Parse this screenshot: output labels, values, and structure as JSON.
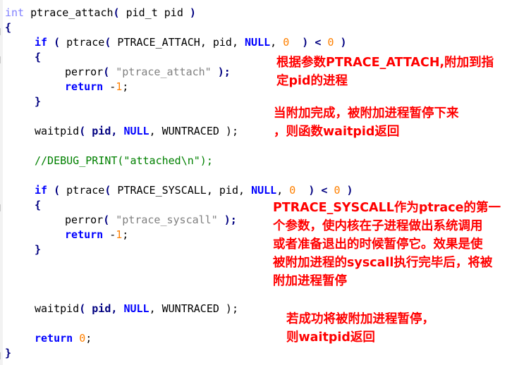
{
  "code": {
    "l1": {
      "type": "int",
      "name": " ptrace_attach",
      "p1": "( ",
      "ptype": "pid_t",
      "pname": " pid ",
      "p2": ")"
    },
    "l2": {
      "brace": "{"
    },
    "l3": {
      "if": "if",
      "a": " ( ",
      "fn": "ptrace",
      "b": "( ",
      "arg1": "PTRACE_ATTACH",
      "c": ", pid, ",
      "null": "NULL",
      "d": ", ",
      "zero": "0",
      "e": "  ) ",
      "lt": "<",
      "f": " ",
      "zero2": "0",
      "g": " )"
    },
    "l4": {
      "brace": "{"
    },
    "l5": {
      "fn": "perror",
      "a": "( ",
      "str": "\"ptrace_attach\"",
      "b": " );"
    },
    "l6": {
      "ret": "return",
      "a": " -",
      "one": "1",
      "b": ";"
    },
    "l7": {
      "brace": "}"
    },
    "l8": {
      "fn": "waitpid",
      "a": "( pid, ",
      "null": "NULL",
      "b": ", WUNTRACED );"
    },
    "l9": {
      "comment": "//DEBUG_PRINT(\"attached\\n\");"
    },
    "l10": {
      "if": "if",
      "a": " ( ",
      "fn": "ptrace",
      "b": "( ",
      "arg1": "PTRACE_SYSCALL",
      "c": ", pid, ",
      "null": "NULL",
      "d": ", ",
      "zero": "0",
      "e": "  ) ",
      "lt": "<",
      "f": " ",
      "zero2": "0",
      "g": " )"
    },
    "l11": {
      "brace": "{"
    },
    "l12": {
      "fn": "perror",
      "a": "( ",
      "str": "\"ptrace_syscall\"",
      "b": " );"
    },
    "l13": {
      "ret": "return",
      "a": " -",
      "one": "1",
      "b": ";"
    },
    "l14": {
      "brace": "}"
    },
    "l15": {
      "fn": "waitpid",
      "a": "( pid, ",
      "null": "NULL",
      "b": ", WUNTRACED );"
    },
    "l16": {
      "ret": "return",
      "a": " ",
      "zero": "0",
      "b": ";"
    },
    "l17": {
      "brace": "}"
    }
  },
  "annotations": {
    "a1": [
      "根据参数PTRACE_ATTACH,附加到指",
      "定pid的进程"
    ],
    "a2": [
      "当附加完成，被附加进程暂停下来",
      "，则函数waitpid返回"
    ],
    "a3": [
      "PTRACE_SYSCALL作为ptrace的第一",
      "个参数，使内核在子进程做出系统调用",
      "或者准备退出的时候暂停它。效果是使",
      "被附加进程的syscall执行完毕后，将被",
      "附加进程暂停"
    ],
    "a4": [
      "若成功将被附加进程暂停，",
      "则waitpid返回"
    ]
  },
  "colors": {
    "keyword": "#0000ff",
    "number": "#ff8000",
    "string": "#808080",
    "comment": "#008000",
    "annotation": "#ff0000",
    "type": "#8080ff"
  }
}
